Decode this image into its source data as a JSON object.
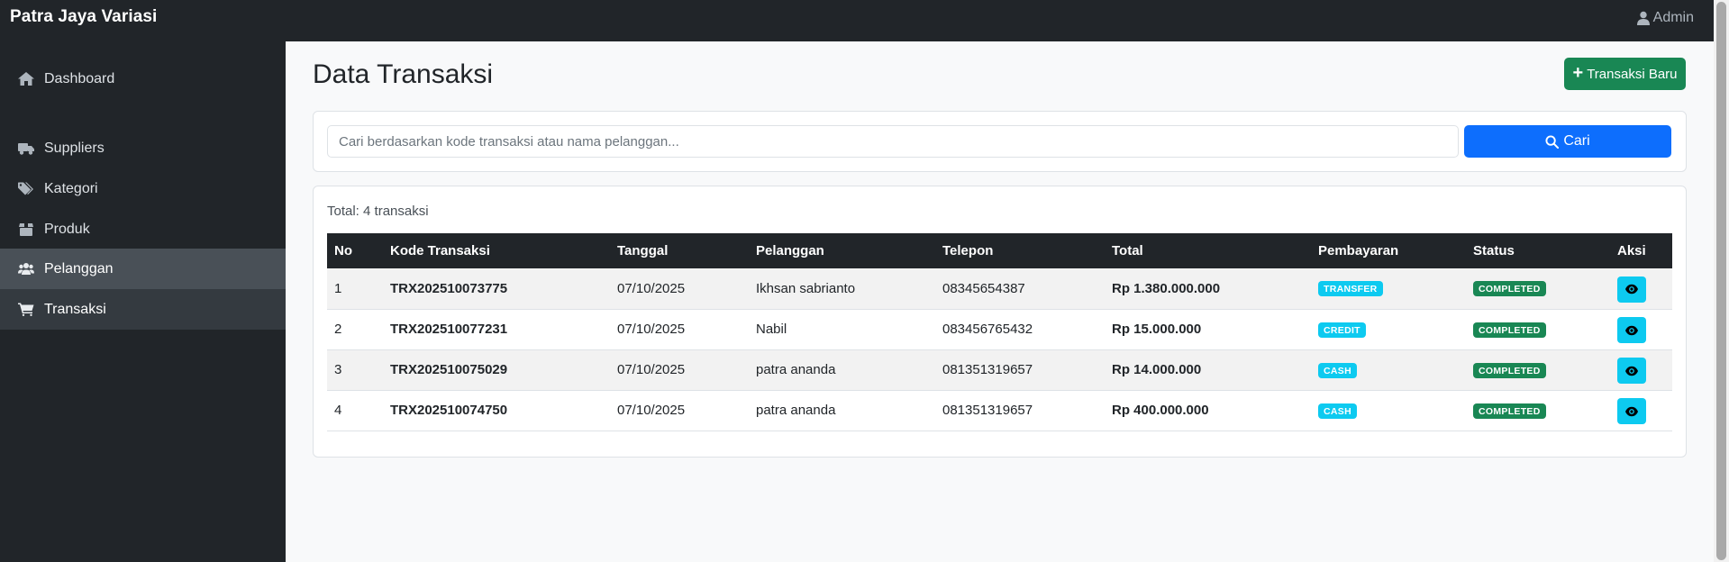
{
  "app": {
    "brand": "Patra Jaya Variasi",
    "user": "Admin"
  },
  "sidebar": {
    "items": [
      {
        "label": "Dashboard",
        "icon": "home-icon"
      },
      {
        "label": "Suppliers",
        "icon": "truck-icon"
      },
      {
        "label": "Kategori",
        "icon": "tags-icon"
      },
      {
        "label": "Produk",
        "icon": "box-icon"
      },
      {
        "label": "Pelanggan",
        "icon": "users-icon"
      },
      {
        "label": "Transaksi",
        "icon": "cart-icon"
      }
    ]
  },
  "page": {
    "title": "Data Transaksi",
    "new_button": "Transaksi Baru"
  },
  "search": {
    "placeholder": "Cari berdasarkan kode transaksi atau nama pelanggan...",
    "button": "Cari"
  },
  "table": {
    "total": "Total: 4 transaksi",
    "columns": [
      "No",
      "Kode Transaksi",
      "Tanggal",
      "Pelanggan",
      "Telepon",
      "Total",
      "Pembayaran",
      "Status",
      "Aksi"
    ],
    "rows": [
      {
        "no": "1",
        "kode": "TRX202510073775",
        "tanggal": "07/10/2025",
        "pelanggan": "Ikhsan sabrianto",
        "telepon": "08345654387",
        "total": "Rp 1.380.000.000",
        "pembayaran": "TRANSFER",
        "status": "COMPLETED"
      },
      {
        "no": "2",
        "kode": "TRX202510077231",
        "tanggal": "07/10/2025",
        "pelanggan": "Nabil",
        "telepon": "083456765432",
        "total": "Rp 15.000.000",
        "pembayaran": "CREDIT",
        "status": "COMPLETED"
      },
      {
        "no": "3",
        "kode": "TRX202510075029",
        "tanggal": "07/10/2025",
        "pelanggan": "patra ananda",
        "telepon": "081351319657",
        "total": "Rp 14.000.000",
        "pembayaran": "CASH",
        "status": "COMPLETED"
      },
      {
        "no": "4",
        "kode": "TRX202510074750",
        "tanggal": "07/10/2025",
        "pelanggan": "patra ananda",
        "telepon": "081351319657",
        "total": "Rp 400.000.000",
        "pembayaran": "CASH",
        "status": "COMPLETED"
      }
    ]
  },
  "colors": {
    "sidebar": "#212529",
    "primary": "#0d6efd",
    "success": "#198754",
    "info": "#0dcaf0"
  }
}
